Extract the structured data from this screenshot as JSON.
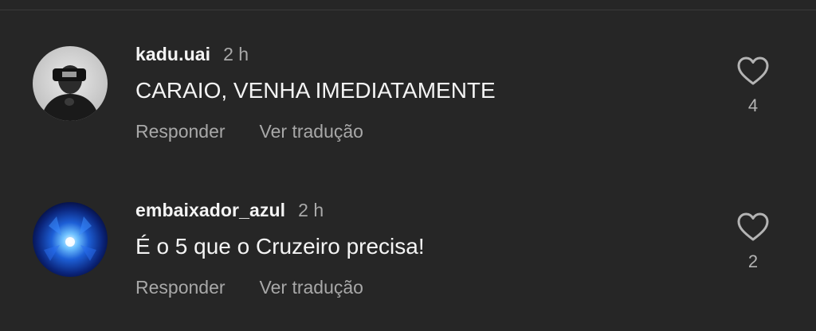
{
  "comments": [
    {
      "username": "kadu.uai",
      "time": "2 h",
      "text": "CARAIO, VENHA IMEDIATAMENTE",
      "reply_label": "Responder",
      "translate_label": "Ver tradução",
      "likes": "4"
    },
    {
      "username": "embaixador_azul",
      "time": "2 h",
      "text": "É o 5 que o Cruzeiro precisa!",
      "reply_label": "Responder",
      "translate_label": "Ver tradução",
      "likes": "2"
    }
  ],
  "colors": {
    "background": "#262626",
    "primary_text": "#f4f4f4",
    "secondary_text": "#a8a8a8",
    "heart_stroke": "#b4b4b4"
  },
  "icons": [
    "heart-outline-icon"
  ]
}
